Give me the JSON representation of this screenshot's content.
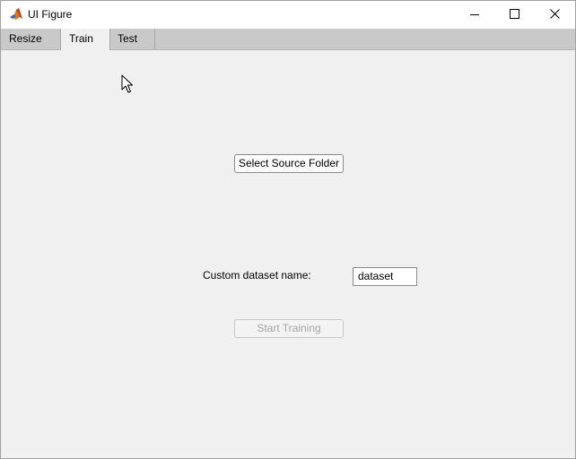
{
  "window": {
    "title": "UI Figure",
    "controls": {
      "minimize": "minimize-icon",
      "maximize": "maximize-icon",
      "close": "close-icon"
    }
  },
  "tabs": [
    {
      "label": "Resize",
      "selected": false
    },
    {
      "label": "Train",
      "selected": true
    },
    {
      "label": "Test",
      "selected": false
    }
  ],
  "train_panel": {
    "select_source_button": "Select Source Folder",
    "dataset_name_label": "Custom dataset name:",
    "dataset_name_value": "dataset",
    "start_training_button": "Start Training",
    "start_training_enabled": false
  },
  "colors": {
    "window_background": "#f0f0f0",
    "tabbar_background": "#c9c9c9",
    "disabled_text": "#a6a6a6"
  }
}
